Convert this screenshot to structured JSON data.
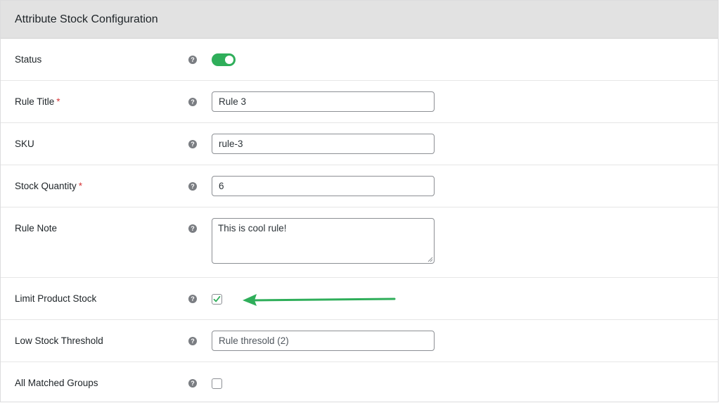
{
  "panel": {
    "title": "Attribute Stock Configuration"
  },
  "rows": {
    "status": {
      "label": "Status",
      "enabled": true
    },
    "rule_title": {
      "label": "Rule Title",
      "required_mark": "*",
      "value": "Rule 3"
    },
    "sku": {
      "label": "SKU",
      "value": "rule-3"
    },
    "stock_quantity": {
      "label": "Stock Quantity",
      "required_mark": "*",
      "value": "6"
    },
    "rule_note": {
      "label": "Rule Note",
      "value": "This is cool rule!"
    },
    "limit_product_stock": {
      "label": "Limit Product Stock",
      "checked": true
    },
    "low_stock_threshold": {
      "label": "Low Stock Threshold",
      "value": "Rule thresold (2)"
    },
    "all_matched_groups": {
      "label": "All Matched Groups",
      "checked": false
    }
  },
  "help_icon_glyph": "?",
  "colors": {
    "header_bg": "#e2e2e2",
    "toggle_on": "#2fae5a",
    "checkmark": "#2fae5a",
    "annotation_arrow": "#2fae5a",
    "required": "#d63638",
    "help_icon": "#7a7d82"
  }
}
